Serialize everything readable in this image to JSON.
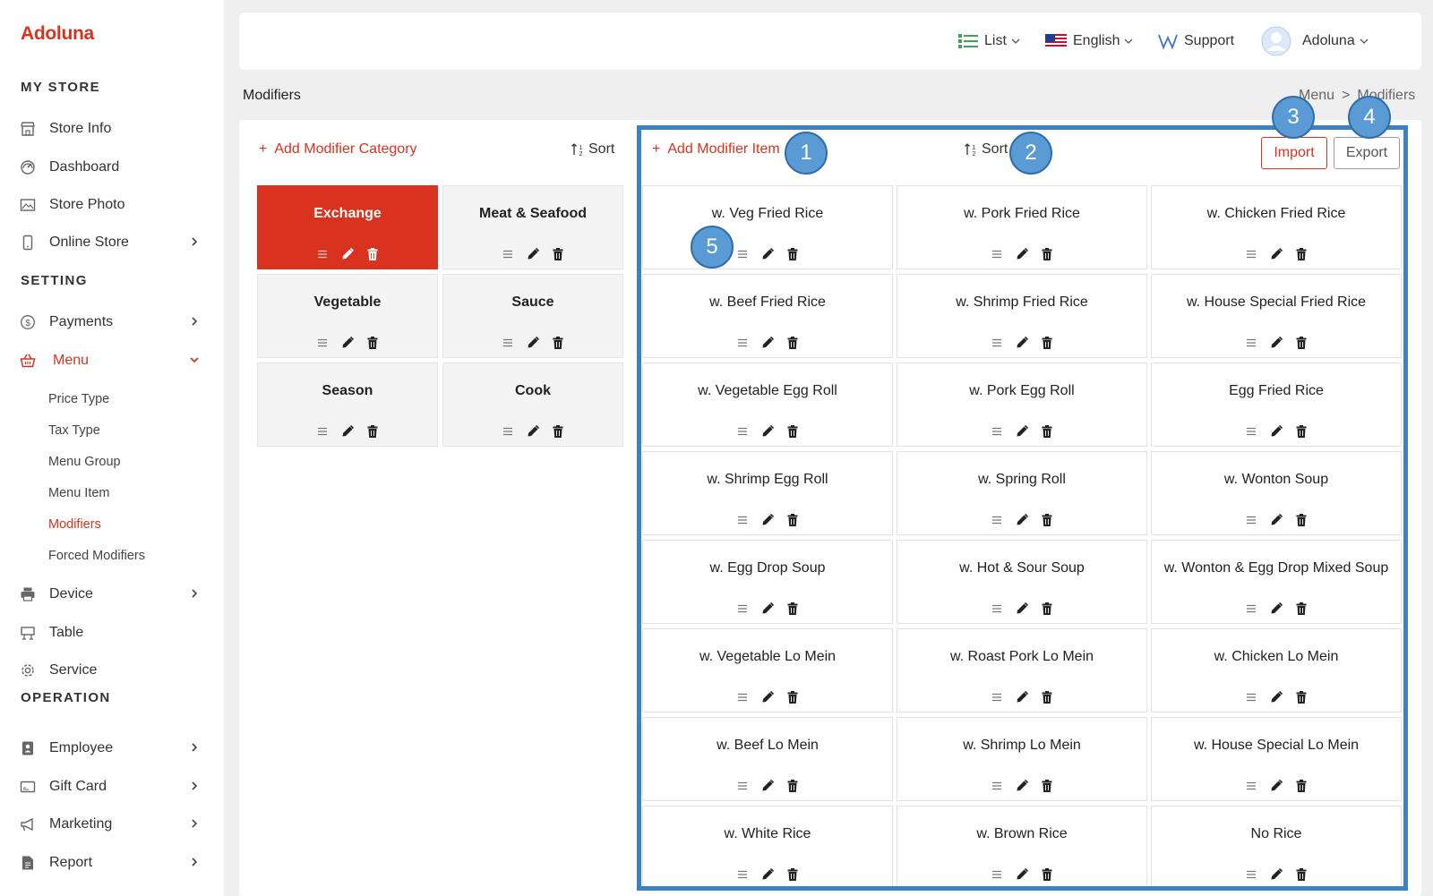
{
  "app": {
    "logo": "Adoluna"
  },
  "sidebar": {
    "sections": {
      "store": "MY STORE",
      "setting": "SETTING",
      "operation": "OPERATION"
    },
    "items": [
      {
        "label": "Store Info",
        "icon": "store-icon"
      },
      {
        "label": "Dashboard",
        "icon": "dashboard-icon"
      },
      {
        "label": "Store Photo",
        "icon": "photo-icon"
      },
      {
        "label": "Online Store",
        "icon": "phone-icon"
      },
      {
        "label": "Payments",
        "icon": "dollar-icon"
      },
      {
        "label": "Menu",
        "icon": "basket-icon"
      },
      {
        "label": "Device",
        "icon": "printer-icon"
      },
      {
        "label": "Table",
        "icon": "table-icon"
      },
      {
        "label": "Service",
        "icon": "gear-icon"
      },
      {
        "label": "Employee",
        "icon": "badge-icon"
      },
      {
        "label": "Gift Card",
        "icon": "gift-card-icon"
      },
      {
        "label": "Marketing",
        "icon": "megaphone-icon"
      },
      {
        "label": "Report",
        "icon": "report-icon"
      }
    ],
    "menu_sub": [
      "Price Type",
      "Tax Type",
      "Menu Group",
      "Menu Item",
      "Modifiers",
      "Forced Modifiers"
    ]
  },
  "topbar": {
    "view": "List",
    "language": "English",
    "support": "Support",
    "user": "Adoluna"
  },
  "page": {
    "title": "Modifiers",
    "breadcrumb": [
      "Menu",
      ">",
      "Modifiers"
    ]
  },
  "categories": {
    "add_label": "Add Modifier Category",
    "sort_label": "Sort",
    "items": [
      "Exchange",
      "Meat & Seafood",
      "Vegetable",
      "Sauce",
      "Season",
      "Cook"
    ]
  },
  "modifiers": {
    "add_label": "Add Modifier Item",
    "sort_label": "Sort",
    "import_label": "Import",
    "export_label": "Export",
    "items": [
      "w. Veg Fried Rice",
      "w. Pork Fried Rice",
      "w. Chicken Fried Rice",
      "w. Beef Fried Rice",
      "w. Shrimp Fried Rice",
      "w. House Special Fried Rice",
      "w. Vegetable Egg Roll",
      "w. Pork Egg Roll",
      "Egg Fried Rice",
      "w. Shrimp Egg Roll",
      "w. Spring Roll",
      "w. Wonton Soup",
      "w. Egg Drop Soup",
      "w. Hot & Sour Soup",
      "w. Wonton & Egg Drop Mixed Soup",
      "w. Vegetable Lo Mein",
      "w. Roast Pork Lo Mein",
      "w. Chicken Lo Mein",
      "w. Beef Lo Mein",
      "w. Shrimp Lo Mein",
      "w. House Special Lo Mein",
      "w. White Rice",
      "w. Brown Rice",
      "No Rice"
    ]
  },
  "markers": [
    "1",
    "2",
    "3",
    "4",
    "5"
  ],
  "colors": {
    "accent": "#d9321f",
    "highlight": "#3b82c4",
    "marker": "#5b9bd5"
  }
}
